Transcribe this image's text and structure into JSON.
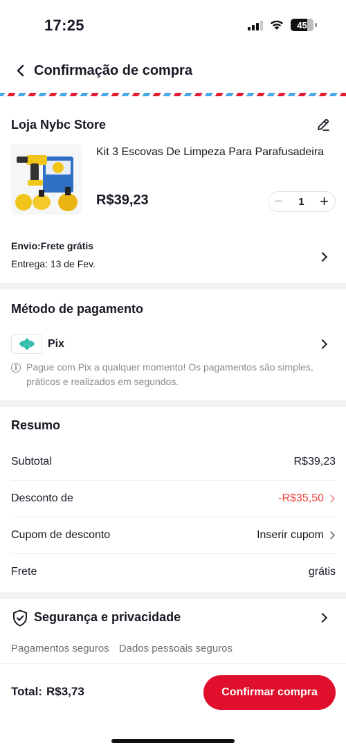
{
  "status_bar": {
    "time": "17:25",
    "battery": "45"
  },
  "header": {
    "title": "Confirmação de compra"
  },
  "store": {
    "name": "Loja Nybc Store",
    "product_title": "Kit 3 Escovas De Limpeza Para Parafusadeira",
    "price": "R$39,23",
    "quantity": "1",
    "shipping_label": "Envio:Frete grátis",
    "delivery_label": "Entrega: 13 de Fev."
  },
  "payment": {
    "title": "Método de pagamento",
    "method": "Pix",
    "info": "Pague com Pix a qualquer momento! Os pagamentos são simples, práticos e realizados em segundos."
  },
  "summary": {
    "title": "Resumo",
    "rows": [
      {
        "label": "Subtotal",
        "value": "R$39,23"
      },
      {
        "label": "Desconto de",
        "value": "-R$35,50"
      },
      {
        "label": "Cupom de desconto",
        "value": "Inserir cupom"
      },
      {
        "label": "Frete",
        "value": "grátis"
      }
    ]
  },
  "security": {
    "title": "Segurança e privacidade",
    "items": [
      "Pagamentos seguros",
      "Dados pessoais seguros"
    ]
  },
  "footer": {
    "total_label": "Total:",
    "total_value": "R$3,73",
    "confirm_label": "Confirmar compra"
  },
  "colors": {
    "accent": "#e00f2b",
    "discount": "#f0413a",
    "pix": "#32bcad"
  }
}
